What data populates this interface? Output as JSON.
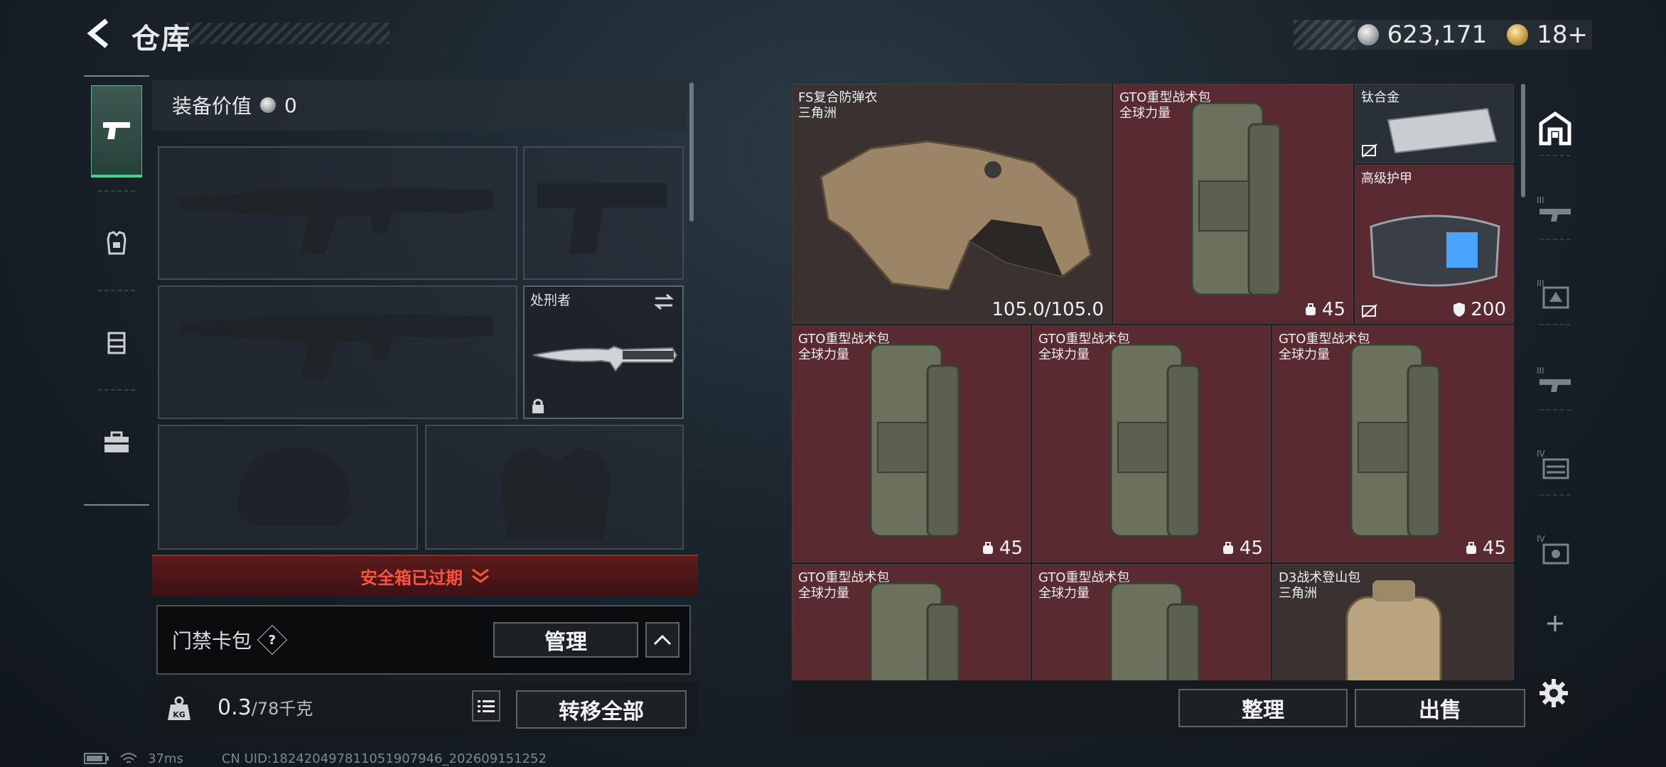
{
  "header": {
    "title": "仓库",
    "currency_silver": "623,171",
    "currency_gold": "18+"
  },
  "side_tabs": [
    "pistol-icon",
    "armor-icon",
    "chest-rig-icon",
    "toolbox-icon"
  ],
  "equipment": {
    "value_label": "装备价值",
    "value": "0",
    "melee_name": "处刑者"
  },
  "safe_box": {
    "label": "安全箱已过期"
  },
  "access_card": {
    "label": "门禁卡包",
    "help": "?",
    "manage_button": "管理"
  },
  "weight": {
    "current": "0.3",
    "max": "/78千克"
  },
  "transfer_all_button": "转移全部",
  "stash": {
    "items": [
      {
        "name": "FS复合防弹衣",
        "sub": "三角洲",
        "value": "105.0/105.0",
        "icon": "armor-vest"
      },
      {
        "name": "GTO重型战术包",
        "sub": "全球力量",
        "value": "45",
        "icon": "backpack"
      },
      {
        "name": "钛合金",
        "sub": "",
        "value": "",
        "icon": "titanium-bar"
      },
      {
        "name": "高级护甲",
        "sub": "",
        "value": "200",
        "icon": "armor-case"
      },
      {
        "name": "GTO重型战术包",
        "sub": "全球力量",
        "value": "45",
        "icon": "backpack"
      },
      {
        "name": "GTO重型战术包",
        "sub": "全球力量",
        "value": "45",
        "icon": "backpack"
      },
      {
        "name": "GTO重型战术包",
        "sub": "全球力量",
        "value": "45",
        "icon": "backpack"
      },
      {
        "name": "GTO重型战术包",
        "sub": "全球力量",
        "value": "",
        "icon": "backpack"
      },
      {
        "name": "GTO重型战术包",
        "sub": "全球力量",
        "value": "",
        "icon": "backpack"
      },
      {
        "name": "D3战术登山包",
        "sub": "三角洲",
        "value": "",
        "icon": "backpack-tan"
      }
    ],
    "organize_button": "整理",
    "sell_button": "出售"
  },
  "rail": {
    "items": [
      "stash-home-icon",
      "rifle-tier3-icon",
      "armor-tier3-icon",
      "rifle-tier3b-icon",
      "case-tier4-icon",
      "weapon-tier4-icon",
      "add-icon"
    ]
  },
  "status": {
    "ping": "37ms",
    "uid": "CN UID:182420497811051907946_202609151252"
  },
  "colors": {
    "accent_green": "#3fd98b",
    "warning_red": "#ff5040",
    "cell_red": "#5a2a31"
  }
}
